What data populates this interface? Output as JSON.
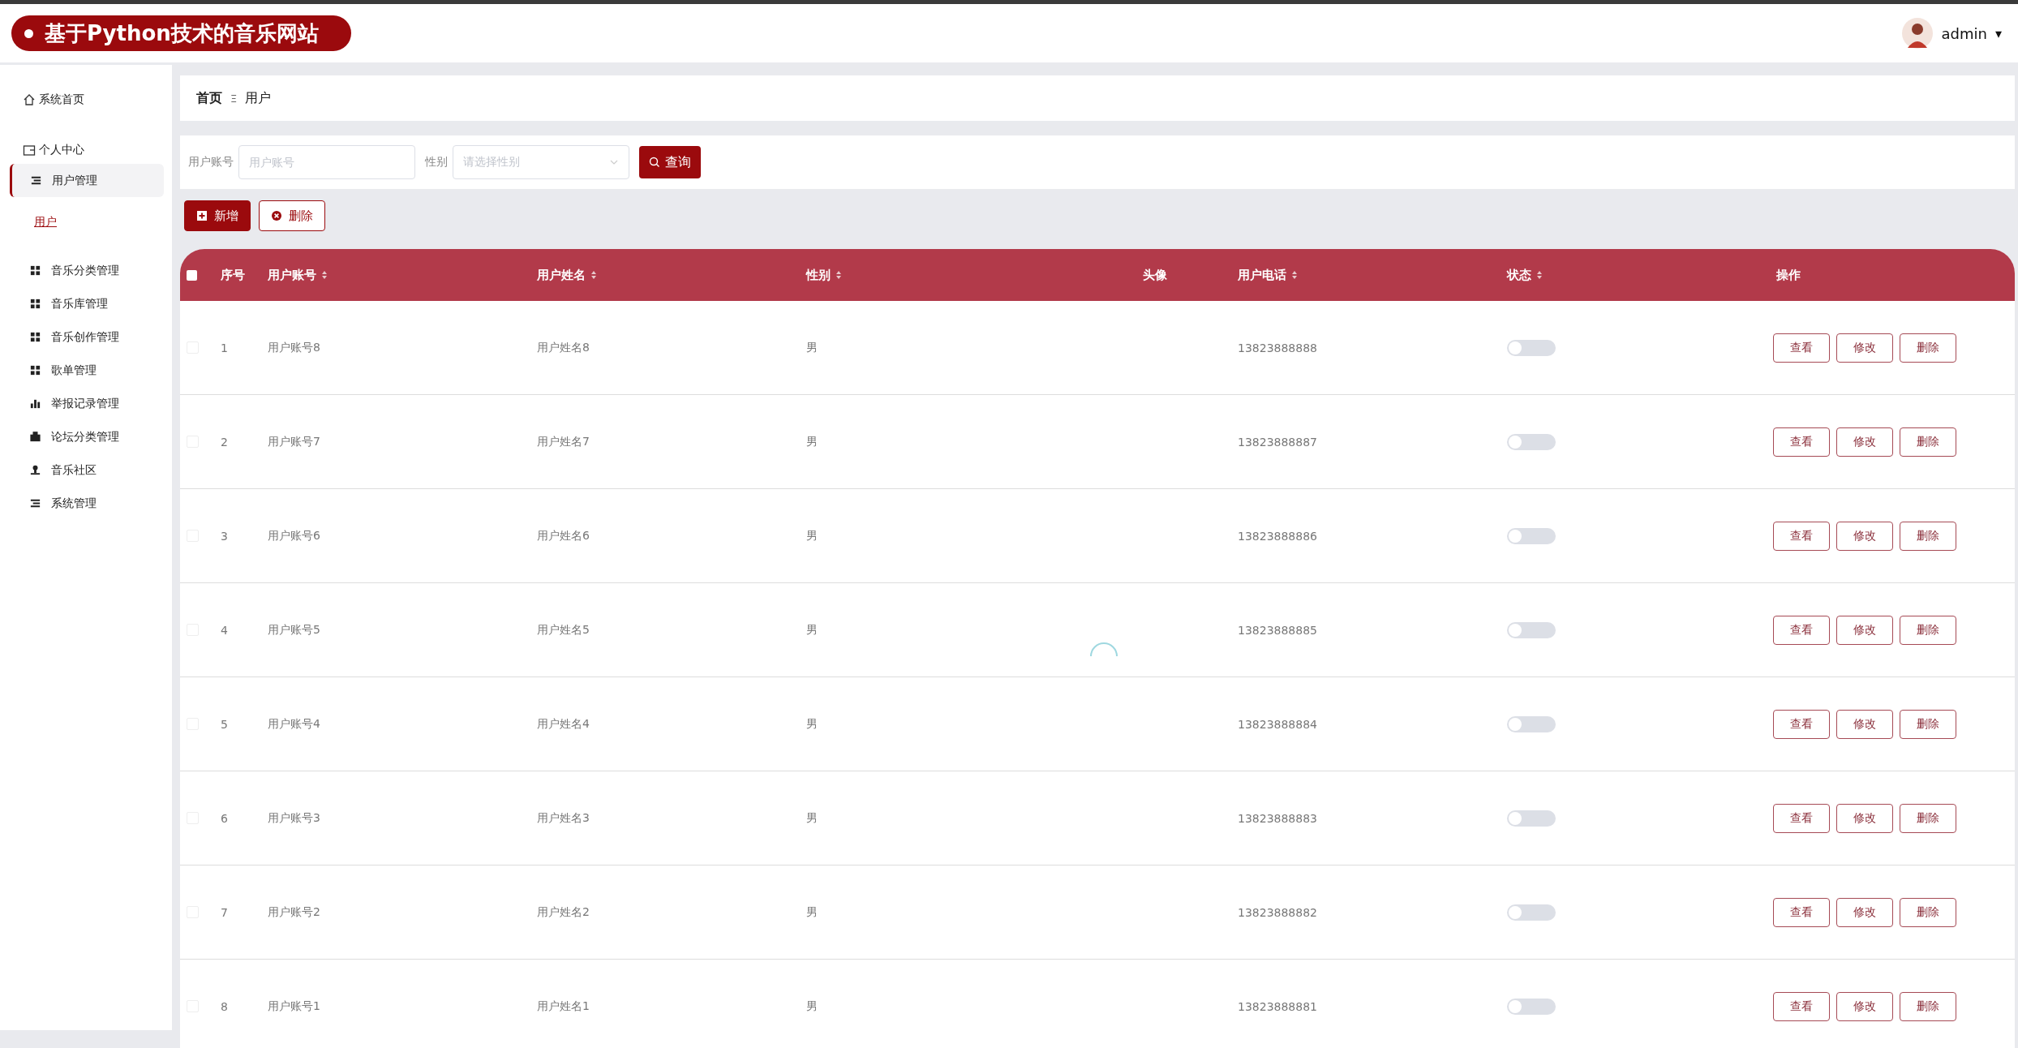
{
  "header": {
    "title": "基于Python技术的音乐网站",
    "user": "admin",
    "caret": "▾"
  },
  "sidebar": {
    "items": [
      {
        "label": "系统首页",
        "kind": "top"
      },
      {
        "label": "个人中心",
        "kind": "group"
      },
      {
        "label": "用户管理",
        "kind": "parent",
        "selected": true,
        "children": [
          {
            "label": "用户",
            "selected": true
          }
        ]
      },
      {
        "label": "音乐分类管理",
        "kind": "item",
        "selected": false
      },
      {
        "label": "音乐库管理",
        "kind": "item",
        "selected": false
      },
      {
        "label": "音乐创作管理",
        "kind": "item",
        "selected": false
      },
      {
        "label": "歌单管理",
        "kind": "item",
        "selected": false
      },
      {
        "label": "举报记录管理",
        "kind": "item",
        "selected": false
      },
      {
        "label": "论坛分类管理",
        "kind": "item",
        "selected": false
      },
      {
        "label": "音乐社区",
        "kind": "item",
        "selected": false
      },
      {
        "label": "系统管理",
        "kind": "item",
        "selected": false
      }
    ]
  },
  "breadcrumb": {
    "home": "首页",
    "separator": "Ξ",
    "current": "用户"
  },
  "search": {
    "fields": [
      {
        "label": "用户账号",
        "placeholder": "用户账号",
        "kind": "text"
      },
      {
        "label": "性别",
        "placeholder": "请选择性别",
        "kind": "select"
      }
    ],
    "button": "查询"
  },
  "actions": [
    {
      "label": "新增",
      "kind": "primary"
    },
    {
      "label": "删除",
      "kind": "outline"
    }
  ],
  "table": {
    "all_checked": false,
    "columns": [
      {
        "label": "序号",
        "sortable": false
      },
      {
        "label": "用户账号",
        "sortable": true
      },
      {
        "label": "用户姓名",
        "sortable": true
      },
      {
        "label": "性别",
        "sortable": true
      },
      {
        "label": "头像",
        "sortable": false
      },
      {
        "label": "用户电话",
        "sortable": true
      },
      {
        "label": "状态",
        "sortable": true
      },
      {
        "label": "操作",
        "sortable": false
      }
    ],
    "rows": [
      {
        "index": "1",
        "account": "用户账号8",
        "name": "用户姓名8",
        "gender": "男",
        "phone": "13823888888",
        "checked": false,
        "on": false,
        "buttons": [
          "查看",
          "修改",
          "删除"
        ]
      },
      {
        "index": "2",
        "account": "用户账号7",
        "name": "用户姓名7",
        "gender": "男",
        "phone": "13823888887",
        "checked": false,
        "on": false,
        "buttons": [
          "查看",
          "修改",
          "删除"
        ]
      },
      {
        "index": "3",
        "account": "用户账号6",
        "name": "用户姓名6",
        "gender": "男",
        "phone": "13823888886",
        "checked": false,
        "on": false,
        "buttons": [
          "查看",
          "修改",
          "删除"
        ]
      },
      {
        "index": "4",
        "account": "用户账号5",
        "name": "用户姓名5",
        "gender": "男",
        "phone": "13823888885",
        "checked": false,
        "on": false,
        "buttons": [
          "查看",
          "修改",
          "删除"
        ]
      },
      {
        "index": "5",
        "account": "用户账号4",
        "name": "用户姓名4",
        "gender": "男",
        "phone": "13823888884",
        "checked": false,
        "on": false,
        "buttons": [
          "查看",
          "修改",
          "删除"
        ]
      },
      {
        "index": "6",
        "account": "用户账号3",
        "name": "用户姓名3",
        "gender": "男",
        "phone": "13823888883",
        "checked": false,
        "on": false,
        "buttons": [
          "查看",
          "修改",
          "删除"
        ]
      },
      {
        "index": "7",
        "account": "用户账号2",
        "name": "用户姓名2",
        "gender": "男",
        "phone": "13823888882",
        "checked": false,
        "on": false,
        "buttons": [
          "查看",
          "修改",
          "删除"
        ]
      },
      {
        "index": "8",
        "account": "用户账号1",
        "name": "用户姓名1",
        "gender": "男",
        "phone": "13823888881",
        "checked": false,
        "on": false,
        "buttons": [
          "查看",
          "修改",
          "删除"
        ]
      }
    ]
  }
}
